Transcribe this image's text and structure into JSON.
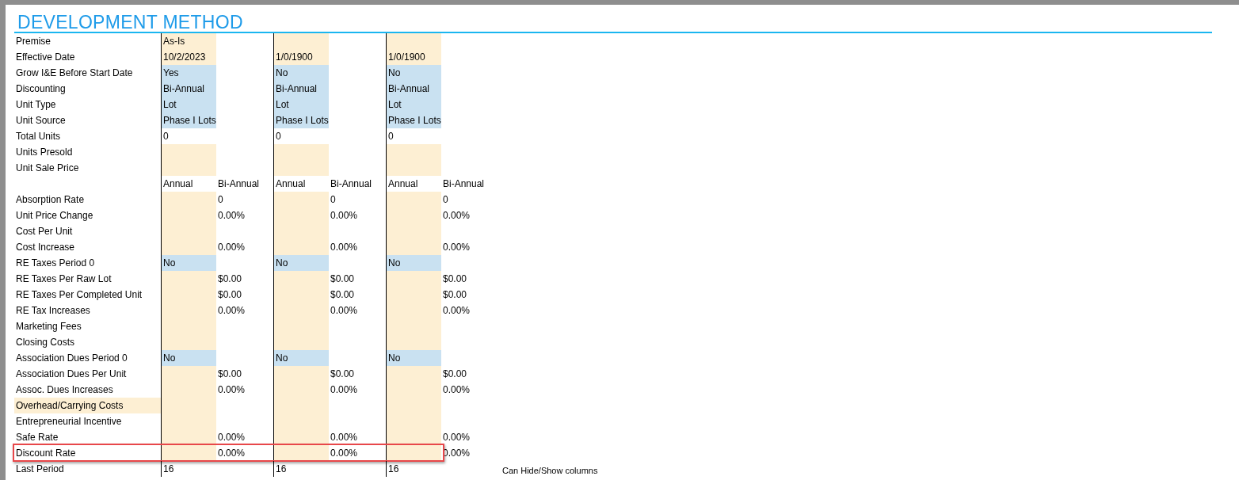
{
  "title": "DEVELOPMENT METHOD",
  "rows": [
    {
      "label": "Premise",
      "label_shaded": false,
      "cells": [
        {
          "kind": "input",
          "text": "As-Is"
        },
        {
          "kind": "plain"
        },
        {
          "kind": "input"
        },
        {
          "kind": "plain"
        },
        {
          "kind": "input"
        },
        {
          "kind": "plain"
        }
      ]
    },
    {
      "label": "Effective Date",
      "label_shaded": false,
      "cells": [
        {
          "kind": "input",
          "text": "10/2/2023"
        },
        {
          "kind": "plain"
        },
        {
          "kind": "input",
          "text": "1/0/1900"
        },
        {
          "kind": "plain"
        },
        {
          "kind": "input",
          "text": "1/0/1900"
        },
        {
          "kind": "plain"
        }
      ]
    },
    {
      "label": "Grow I&E Before Start Date",
      "label_shaded": false,
      "cells": [
        {
          "kind": "dropdown",
          "text": "Yes"
        },
        {
          "kind": "plain"
        },
        {
          "kind": "dropdown",
          "text": "No"
        },
        {
          "kind": "plain"
        },
        {
          "kind": "dropdown",
          "text": "No"
        },
        {
          "kind": "plain"
        }
      ]
    },
    {
      "label": "Discounting",
      "label_shaded": false,
      "cells": [
        {
          "kind": "dropdown",
          "text": "Bi-Annual"
        },
        {
          "kind": "plain"
        },
        {
          "kind": "dropdown",
          "text": "Bi-Annual"
        },
        {
          "kind": "plain"
        },
        {
          "kind": "dropdown",
          "text": "Bi-Annual"
        },
        {
          "kind": "plain"
        }
      ]
    },
    {
      "label": "Unit Type",
      "label_shaded": false,
      "cells": [
        {
          "kind": "dropdown",
          "text": "Lot"
        },
        {
          "kind": "plain"
        },
        {
          "kind": "dropdown",
          "text": "Lot"
        },
        {
          "kind": "plain"
        },
        {
          "kind": "dropdown",
          "text": "Lot"
        },
        {
          "kind": "plain"
        }
      ]
    },
    {
      "label": "Unit Source",
      "label_shaded": false,
      "cells": [
        {
          "kind": "dropdown",
          "text": "Phase I Lots"
        },
        {
          "kind": "plain"
        },
        {
          "kind": "dropdown",
          "text": "Phase I Lots"
        },
        {
          "kind": "plain"
        },
        {
          "kind": "dropdown",
          "text": "Phase I Lots"
        },
        {
          "kind": "plain"
        }
      ]
    },
    {
      "label": "Total Units",
      "label_shaded": false,
      "cells": [
        {
          "kind": "plain",
          "text": "0"
        },
        {
          "kind": "plain"
        },
        {
          "kind": "plain",
          "text": "0"
        },
        {
          "kind": "plain"
        },
        {
          "kind": "plain",
          "text": "0"
        },
        {
          "kind": "plain"
        }
      ]
    },
    {
      "label": "Units Presold",
      "label_shaded": false,
      "cells": [
        {
          "kind": "input"
        },
        {
          "kind": "plain"
        },
        {
          "kind": "input"
        },
        {
          "kind": "plain"
        },
        {
          "kind": "input"
        },
        {
          "kind": "plain"
        }
      ]
    },
    {
      "label": "Unit Sale Price",
      "label_shaded": false,
      "cells": [
        {
          "kind": "input"
        },
        {
          "kind": "plain"
        },
        {
          "kind": "input"
        },
        {
          "kind": "plain"
        },
        {
          "kind": "input"
        },
        {
          "kind": "plain"
        }
      ]
    },
    {
      "cells": [
        {
          "kind": "plain",
          "text": "Annual"
        },
        {
          "kind": "plain",
          "text": "Bi-Annual"
        },
        {
          "kind": "plain",
          "text": "Annual"
        },
        {
          "kind": "plain",
          "text": "Bi-Annual"
        },
        {
          "kind": "plain",
          "text": "Annual"
        },
        {
          "kind": "plain",
          "text": "Bi-Annual"
        }
      ]
    },
    {
      "label": "Absorption Rate",
      "label_shaded": false,
      "cells": [
        {
          "kind": "input"
        },
        {
          "kind": "plain",
          "text": "0"
        },
        {
          "kind": "input"
        },
        {
          "kind": "plain",
          "text": "0"
        },
        {
          "kind": "input"
        },
        {
          "kind": "plain",
          "text": "0"
        }
      ]
    },
    {
      "label": "Unit Price Change",
      "label_shaded": false,
      "cells": [
        {
          "kind": "input"
        },
        {
          "kind": "plain",
          "text": "0.00%"
        },
        {
          "kind": "input"
        },
        {
          "kind": "plain",
          "text": "0.00%"
        },
        {
          "kind": "input"
        },
        {
          "kind": "plain",
          "text": "0.00%"
        }
      ]
    },
    {
      "label": "Cost Per Unit",
      "label_shaded": false,
      "cells": [
        {
          "kind": "input"
        },
        {
          "kind": "plain"
        },
        {
          "kind": "input"
        },
        {
          "kind": "plain"
        },
        {
          "kind": "input"
        },
        {
          "kind": "plain"
        }
      ]
    },
    {
      "label": "Cost Increase",
      "label_shaded": false,
      "cells": [
        {
          "kind": "input"
        },
        {
          "kind": "plain",
          "text": "0.00%"
        },
        {
          "kind": "input"
        },
        {
          "kind": "plain",
          "text": "0.00%"
        },
        {
          "kind": "input"
        },
        {
          "kind": "plain",
          "text": "0.00%"
        }
      ]
    },
    {
      "label": "RE Taxes Period 0",
      "label_shaded": false,
      "cells": [
        {
          "kind": "dropdown",
          "text": "No"
        },
        {
          "kind": "plain"
        },
        {
          "kind": "dropdown",
          "text": "No"
        },
        {
          "kind": "plain"
        },
        {
          "kind": "dropdown",
          "text": "No"
        },
        {
          "kind": "plain"
        }
      ]
    },
    {
      "label": "RE Taxes Per Raw Lot",
      "label_shaded": false,
      "cells": [
        {
          "kind": "input"
        },
        {
          "kind": "plain",
          "text": "$0.00"
        },
        {
          "kind": "input"
        },
        {
          "kind": "plain",
          "text": "$0.00"
        },
        {
          "kind": "input"
        },
        {
          "kind": "plain",
          "text": "$0.00"
        }
      ]
    },
    {
      "label": "RE Taxes Per Completed Unit",
      "label_shaded": false,
      "cells": [
        {
          "kind": "input"
        },
        {
          "kind": "plain",
          "text": "$0.00"
        },
        {
          "kind": "input"
        },
        {
          "kind": "plain",
          "text": "$0.00"
        },
        {
          "kind": "input"
        },
        {
          "kind": "plain",
          "text": "$0.00"
        }
      ]
    },
    {
      "label": "RE Tax Increases",
      "label_shaded": false,
      "cells": [
        {
          "kind": "input"
        },
        {
          "kind": "plain",
          "text": "0.00%"
        },
        {
          "kind": "input"
        },
        {
          "kind": "plain",
          "text": "0.00%"
        },
        {
          "kind": "input"
        },
        {
          "kind": "plain",
          "text": "0.00%"
        }
      ]
    },
    {
      "label": "Marketing Fees",
      "label_shaded": false,
      "cells": [
        {
          "kind": "input"
        },
        {
          "kind": "plain"
        },
        {
          "kind": "input"
        },
        {
          "kind": "plain"
        },
        {
          "kind": "input"
        },
        {
          "kind": "plain"
        }
      ]
    },
    {
      "label": "Closing Costs",
      "label_shaded": false,
      "cells": [
        {
          "kind": "input"
        },
        {
          "kind": "plain"
        },
        {
          "kind": "input"
        },
        {
          "kind": "plain"
        },
        {
          "kind": "input"
        },
        {
          "kind": "plain"
        }
      ]
    },
    {
      "label": "Association Dues Period 0",
      "label_shaded": false,
      "cells": [
        {
          "kind": "dropdown",
          "text": "No"
        },
        {
          "kind": "plain"
        },
        {
          "kind": "dropdown",
          "text": "No"
        },
        {
          "kind": "plain"
        },
        {
          "kind": "dropdown",
          "text": "No"
        },
        {
          "kind": "plain"
        }
      ]
    },
    {
      "label": "Association Dues Per Unit",
      "label_shaded": false,
      "cells": [
        {
          "kind": "input"
        },
        {
          "kind": "plain",
          "text": "$0.00"
        },
        {
          "kind": "input"
        },
        {
          "kind": "plain",
          "text": "$0.00"
        },
        {
          "kind": "input"
        },
        {
          "kind": "plain",
          "text": "$0.00"
        }
      ]
    },
    {
      "label": "Assoc. Dues Increases",
      "label_shaded": false,
      "cells": [
        {
          "kind": "input"
        },
        {
          "kind": "plain",
          "text": "0.00%"
        },
        {
          "kind": "input"
        },
        {
          "kind": "plain",
          "text": "0.00%"
        },
        {
          "kind": "input"
        },
        {
          "kind": "plain",
          "text": "0.00%"
        }
      ]
    },
    {
      "label": "Overhead/Carrying Costs",
      "label_shaded": true,
      "cells": [
        {
          "kind": "input"
        },
        {
          "kind": "plain"
        },
        {
          "kind": "input"
        },
        {
          "kind": "plain"
        },
        {
          "kind": "input"
        },
        {
          "kind": "plain"
        }
      ]
    },
    {
      "label": "Entrepreneurial Incentive",
      "label_shaded": false,
      "cells": [
        {
          "kind": "input"
        },
        {
          "kind": "plain"
        },
        {
          "kind": "input"
        },
        {
          "kind": "plain"
        },
        {
          "kind": "input"
        },
        {
          "kind": "plain"
        }
      ]
    },
    {
      "label": "Safe Rate",
      "label_shaded": false,
      "cells": [
        {
          "kind": "input"
        },
        {
          "kind": "plain",
          "text": "0.00%"
        },
        {
          "kind": "input"
        },
        {
          "kind": "plain",
          "text": "0.00%"
        },
        {
          "kind": "input"
        },
        {
          "kind": "plain",
          "text": "0.00%"
        }
      ]
    },
    {
      "label": "Discount Rate",
      "label_shaded": false,
      "highlighted": true,
      "cells": [
        {
          "kind": "input"
        },
        {
          "kind": "plain",
          "text": "0.00%"
        },
        {
          "kind": "input"
        },
        {
          "kind": "plain",
          "text": "0.00%"
        },
        {
          "kind": "input"
        },
        {
          "kind": "plain",
          "text": "0.00%"
        }
      ]
    },
    {
      "label": "Last Period",
      "label_shaded": false,
      "note": "Can Hide/Show columns",
      "cells": [
        {
          "kind": "plain",
          "text": "16"
        },
        {
          "kind": "plain"
        },
        {
          "kind": "plain",
          "text": "16"
        },
        {
          "kind": "plain"
        },
        {
          "kind": "plain",
          "text": "16"
        },
        {
          "kind": "plain"
        }
      ]
    }
  ]
}
